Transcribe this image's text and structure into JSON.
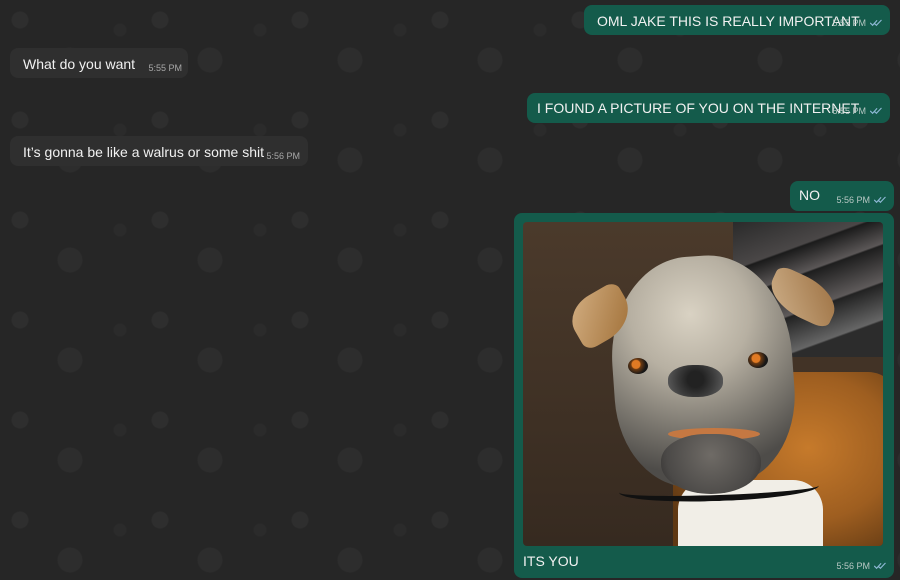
{
  "conversation": {
    "messages": [
      {
        "direction": "outgoing",
        "text": "OML JAKE THIS IS REALLY IMPORTANT",
        "time": "5:55 PM",
        "status_icon": "double-check-icon"
      },
      {
        "direction": "incoming",
        "text": "What do you want",
        "time": "5:55 PM"
      },
      {
        "direction": "outgoing",
        "text": "I FOUND A PICTURE OF YOU ON THE INTERNET",
        "time": "5:55 PM",
        "status_icon": "double-check-icon"
      },
      {
        "direction": "incoming",
        "text": "It’s gonna be like a walrus or some shit",
        "time": "5:56 PM"
      },
      {
        "direction": "outgoing",
        "text": "NO",
        "time": "5:56 PM",
        "status_icon": "double-check-icon"
      },
      {
        "direction": "outgoing",
        "image": "dog-photo",
        "text": "ITS YOU",
        "time": "5:56 PM",
        "status_icon": "double-check-icon"
      }
    ]
  },
  "colors": {
    "background": "#262626",
    "incoming_bubble": "#2f2f2f",
    "outgoing_bubble": "#145b4b",
    "tick_color": "#8fb9d6"
  }
}
